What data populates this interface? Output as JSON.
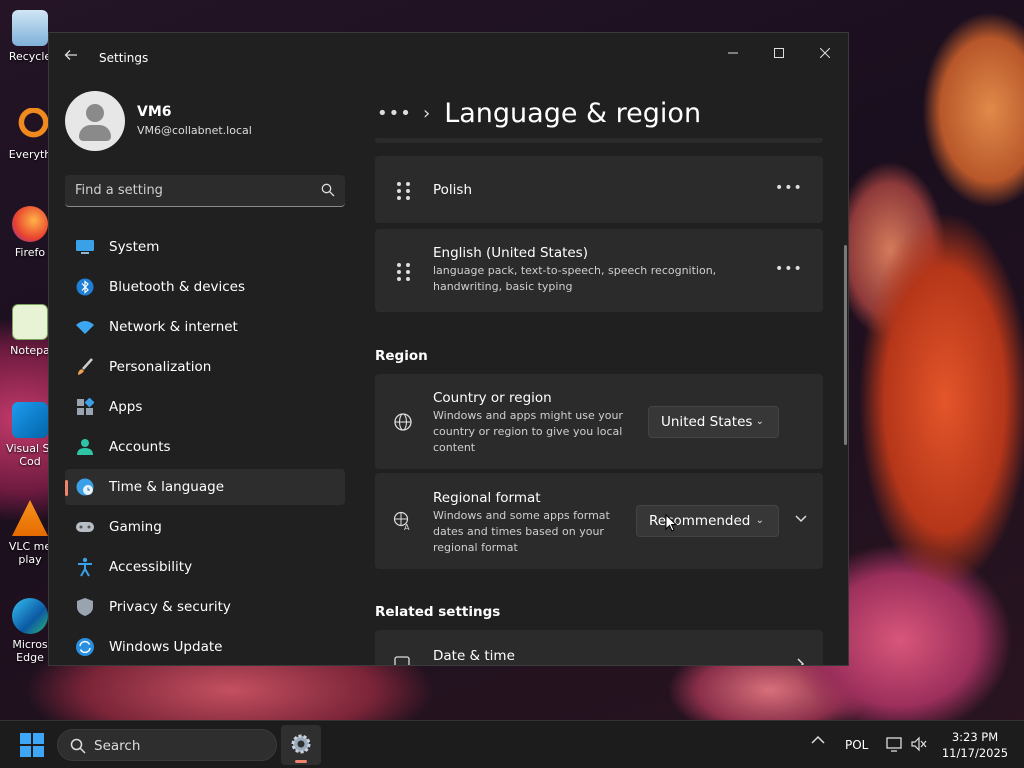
{
  "desktop": {
    "icons": [
      {
        "label": "Recycle",
        "icon": "recycle-bin-icon"
      },
      {
        "label": "Everyth",
        "icon": "everything-search-icon"
      },
      {
        "label": "Firefo",
        "icon": "firefox-icon"
      },
      {
        "label": "Notepa",
        "icon": "notepad-icon"
      },
      {
        "label": "Visual St\nCod",
        "icon": "vscode-icon"
      },
      {
        "label": "VLC me\nplay",
        "icon": "vlc-icon"
      },
      {
        "label": "Micros\nEdge",
        "icon": "edge-icon"
      }
    ]
  },
  "window": {
    "title": "Settings",
    "back_icon": "back-arrow-icon",
    "controls": [
      "minimize-icon",
      "maximize-icon",
      "close-icon"
    ]
  },
  "profile": {
    "name": "VM6",
    "email": "VM6@collabnet.local"
  },
  "search": {
    "placeholder": "Find a setting"
  },
  "nav": {
    "items": [
      {
        "label": "System",
        "icon": "system-icon"
      },
      {
        "label": "Bluetooth & devices",
        "icon": "bluetooth-icon"
      },
      {
        "label": "Network & internet",
        "icon": "wifi-icon"
      },
      {
        "label": "Personalization",
        "icon": "brush-icon"
      },
      {
        "label": "Apps",
        "icon": "apps-icon"
      },
      {
        "label": "Accounts",
        "icon": "accounts-icon"
      },
      {
        "label": "Time & language",
        "icon": "globe-clock-icon",
        "active": true
      },
      {
        "label": "Gaming",
        "icon": "gamepad-icon"
      },
      {
        "label": "Accessibility",
        "icon": "accessibility-icon"
      },
      {
        "label": "Privacy & security",
        "icon": "shield-icon"
      },
      {
        "label": "Windows Update",
        "icon": "update-icon"
      }
    ]
  },
  "main": {
    "breadcrumb_more": "•••",
    "page_title": "Language & region",
    "languages": [
      {
        "name": "Polish",
        "details": ""
      },
      {
        "name": "English (United States)",
        "details": "language pack, text-to-speech, speech recognition, handwriting, basic typing"
      }
    ],
    "more_label": "•••",
    "region_heading": "Region",
    "country": {
      "title": "Country or region",
      "desc": "Windows and apps might use your country or region to give you local content",
      "value": "United States"
    },
    "regional_format": {
      "title": "Regional format",
      "desc": "Windows and some apps format dates and times based on your regional format",
      "value": "Recommended"
    },
    "related_heading": "Related settings",
    "related": [
      {
        "title": "Date & time"
      }
    ]
  },
  "taskbar": {
    "search_label": "Search",
    "language": "POL",
    "time": "3:23 PM",
    "date": "11/17/2025"
  },
  "colors": {
    "accent": "#f0836e",
    "window_bg": "#202020",
    "card_bg": "#2b2b2b"
  }
}
